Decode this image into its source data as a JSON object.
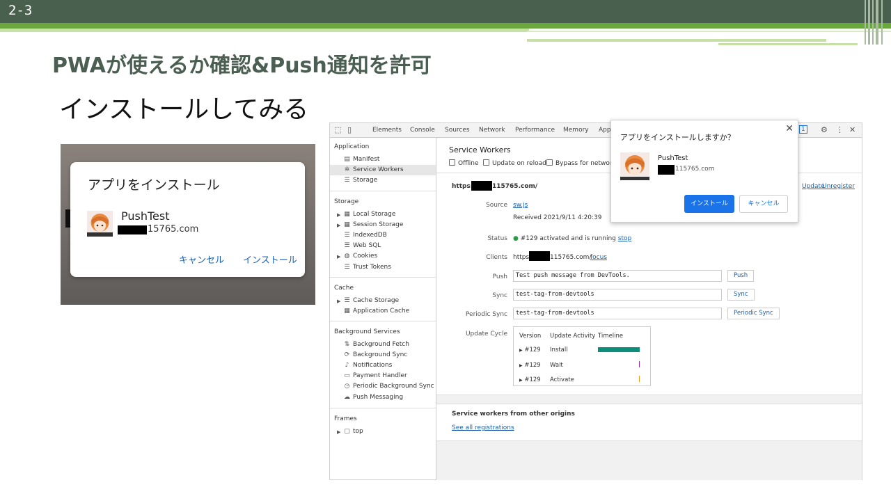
{
  "slide": {
    "number": "2-3",
    "title": "PWAが使えるか確認&Push通知を許可",
    "subtitle": "インストールしてみる"
  },
  "android_dialog": {
    "title": "アプリをインストール",
    "app_name": "PushTest",
    "domain": "15765.com",
    "cancel": "キャンセル",
    "install": "インストール"
  },
  "devtools": {
    "tabs": [
      "Elements",
      "Console",
      "Sources",
      "Network",
      "Performance",
      "Memory",
      "Appl"
    ],
    "badge": "1",
    "sidebar": {
      "application_header": "Application",
      "application_items": [
        "Manifest",
        "Service Workers",
        "Storage"
      ],
      "storage_header": "Storage",
      "storage_items": [
        "Local Storage",
        "Session Storage",
        "IndexedDB",
        "Web SQL",
        "Cookies",
        "Trust Tokens"
      ],
      "cache_header": "Cache",
      "cache_items": [
        "Cache Storage",
        "Application Cache"
      ],
      "bg_header": "Background Services",
      "bg_items": [
        "Background Fetch",
        "Background Sync",
        "Notifications",
        "Payment Handler",
        "Periodic Background Sync",
        "Push Messaging"
      ],
      "frames_header": "Frames",
      "frames_items": [
        "top"
      ]
    },
    "main": {
      "header": "Service Workers",
      "opt_offline": "Offline",
      "opt_update": "Update on reload",
      "opt_bypass": "Bypass for network",
      "origin_prefix": "https:",
      "origin_suffix": "115765.com/",
      "update_link": "Update",
      "unregister_link": "Unregister",
      "source_label": "Source",
      "source_value": "sw.js",
      "received": "Received 2021/9/11 4:20:39",
      "status_label": "Status",
      "status_value": "#129 activated and is running",
      "stop_link": "stop",
      "clients_label": "Clients",
      "clients_prefix": "https:",
      "clients_suffix": "115765.com/",
      "focus_link": "focus",
      "push_label": "Push",
      "push_value": "Test push message from DevTools.",
      "push_button": "Push",
      "sync_label": "Sync",
      "sync_value": "test-tag-from-devtools",
      "sync_button": "Sync",
      "psync_label": "Periodic Sync",
      "psync_value": "test-tag-from-devtools",
      "psync_button": "Periodic Sync",
      "uc_label": "Update Cycle",
      "uc_headers": [
        "Version",
        "Update Activity",
        "Timeline"
      ],
      "uc_rows": [
        {
          "version": "#129",
          "activity": "Install"
        },
        {
          "version": "#129",
          "activity": "Wait"
        },
        {
          "version": "#129",
          "activity": "Activate"
        }
      ],
      "other_header": "Service workers from other origins",
      "see_all": "See all registrations"
    }
  },
  "chrome_popup": {
    "title": "アプリをインストールしますか？",
    "app_name": "PushTest",
    "domain": "115765.com",
    "install": "インストール",
    "cancel": "キャンセル"
  },
  "colors": {
    "topbar": "#49604f",
    "green": "#6aa83d",
    "install_timeline": "#0b8f7a",
    "wait_timeline": "#9c27b0",
    "activate_timeline": "#f29a1f",
    "link": "#1a5fb4",
    "primary": "#1a73e8"
  }
}
